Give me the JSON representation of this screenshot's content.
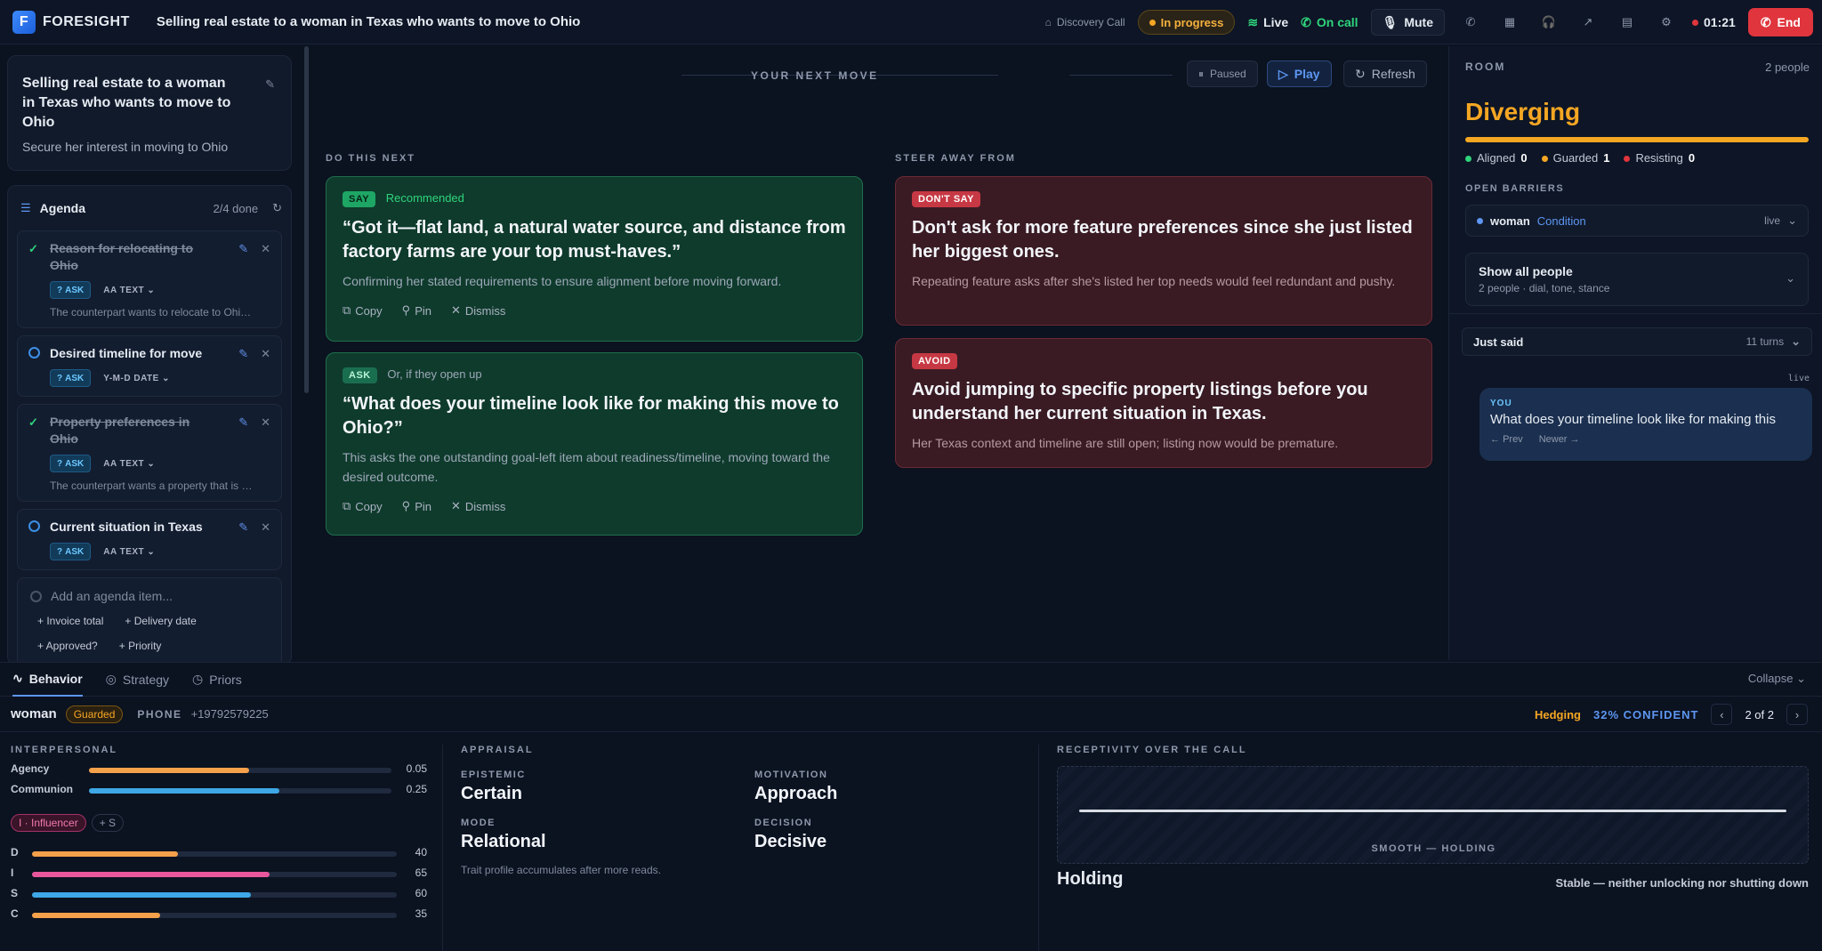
{
  "app": {
    "name": "FORESIGHT",
    "logo_letter": "F",
    "title": "Selling real estate to a woman in Texas who wants to move to Ohio"
  },
  "topbar": {
    "tag": "Discovery Call",
    "status": "In progress",
    "live": "Live",
    "oncall": "On call",
    "mute": "Mute",
    "timer": "01:21",
    "end": "End",
    "colors": {
      "status": "#f5a623",
      "oncall": "#2fd47c",
      "end": "#e0353d"
    }
  },
  "deal": {
    "title": "Selling real estate to a woman in Texas who wants to move to Ohio",
    "subtitle": "Secure her interest in moving to Ohio"
  },
  "agenda": {
    "label": "Agenda",
    "count": "2/4 done",
    "items": [
      {
        "title": "Reason for relocating to Ohio",
        "done": true,
        "badge": "ASK",
        "type": "AA TEXT",
        "note": "The counterpart wants to relocate to Ohio ..."
      },
      {
        "title": "Desired timeline for move",
        "done": false,
        "badge": "ASK",
        "type": "Y-M-D DATE",
        "note": ""
      },
      {
        "title": "Property preferences in Ohio",
        "done": true,
        "badge": "ASK",
        "type": "AA TEXT",
        "note": "The counterpart wants a property that is a..."
      },
      {
        "title": "Current situation in Texas",
        "done": false,
        "badge": "ASK",
        "type": "AA TEXT",
        "note": ""
      }
    ],
    "add_placeholder": "Add an agenda item...",
    "suggestions": [
      "+ Invoice total",
      "+ Delivery date",
      "+ Approved?",
      "+ Priority"
    ]
  },
  "next_move": {
    "title": "YOUR NEXT MOVE",
    "paused": "Paused",
    "play": "Play",
    "refresh": "Refresh",
    "do_label": "DO THIS NEXT",
    "steer_label": "STEER AWAY FROM",
    "do": [
      {
        "badge": "SAY",
        "sub": "Recommended",
        "quote": "“Got it—flat land, a natural water source, and distance from factory farms are your top must-haves.”",
        "why": "Confirming her stated requirements to ensure alignment before moving forward."
      },
      {
        "badge": "ASK",
        "sub": "Or, if they open up",
        "quote": "“What does your timeline look like for making this move to Ohio?”",
        "why": "This asks the one outstanding goal-left item about readiness/timeline, moving toward the desired outcome."
      }
    ],
    "avoid": [
      {
        "badge": "DON'T SAY",
        "title": "Don't ask for more feature preferences since she just listed her biggest ones.",
        "why": "Repeating feature asks after she's listed her top needs would feel redundant and pushy."
      },
      {
        "badge": "AVOID",
        "title": "Avoid jumping to specific property listings before you understand her current situation in Texas.",
        "why": "Her Texas context and timeline are still open; listing now would be premature."
      }
    ],
    "actions": {
      "copy": "Copy",
      "pin": "Pin",
      "dismiss": "Dismiss"
    }
  },
  "room": {
    "label": "ROOM",
    "count": "2 people",
    "state": "Diverging",
    "state_color": "#f5a623",
    "stances": [
      {
        "label": "Aligned",
        "value": "0",
        "color": "#2fd47c"
      },
      {
        "label": "Guarded",
        "value": "1",
        "color": "#f5a623"
      },
      {
        "label": "Resisting",
        "value": "0",
        "color": "#e0353d"
      }
    ],
    "barriers_label": "OPEN BARRIERS",
    "barrier": {
      "who": "woman",
      "what": "Condition",
      "status": "live"
    },
    "show_all": {
      "title": "Show all people",
      "sub": "2 people · dial, tone, stance"
    },
    "just_said": {
      "label": "Just said",
      "turns": "11 turns",
      "live": "live",
      "speaker": "YOU",
      "message": "What does your timeline look like for making this",
      "prev": "Prev",
      "newer": "Newer"
    }
  },
  "bottom": {
    "tabs": [
      "Behavior",
      "Strategy",
      "Priors"
    ],
    "collapse": "Collapse",
    "person": {
      "name": "woman",
      "stance": "Guarded",
      "phone_label": "PHONE",
      "phone": "+19792579225"
    },
    "hedging": "Hedging",
    "confidence": "32% CONFIDENT",
    "pager": "2 of 2",
    "interpersonal": {
      "label": "INTERPERSONAL",
      "bars": [
        {
          "key": "Agency",
          "value": "0.05",
          "fill": 0.53,
          "color": "#f5a04a"
        },
        {
          "key": "Communion",
          "value": "0.25",
          "fill": 0.63,
          "color": "#3ea7e6"
        }
      ],
      "disc_badge": "I · Influencer",
      "disc_secondary": "+ S",
      "disc": [
        {
          "key": "D",
          "value": "40",
          "fill": 0.4,
          "color": "#f5a04a"
        },
        {
          "key": "I",
          "value": "65",
          "fill": 0.65,
          "color": "#e8579b"
        },
        {
          "key": "S",
          "value": "60",
          "fill": 0.6,
          "color": "#3ea7e6"
        },
        {
          "key": "C",
          "value": "35",
          "fill": 0.35,
          "color": "#f5a04a"
        }
      ]
    },
    "appraisal": {
      "label": "APPRAISAL",
      "epistemic_k": "EPISTEMIC",
      "epistemic_v": "Certain",
      "motivation_k": "MOTIVATION",
      "motivation_v": "Approach",
      "mode_k": "MODE",
      "mode_v": "Relational",
      "decision_k": "DECISION",
      "decision_v": "Decisive",
      "note": "Trait profile accumulates after more reads."
    },
    "receptivity": {
      "label": "RECEPTIVITY OVER THE CALL",
      "chart_caption": "SMOOTH — HOLDING",
      "state": "Holding",
      "desc": "Stable — neither unlocking nor shutting down"
    }
  }
}
